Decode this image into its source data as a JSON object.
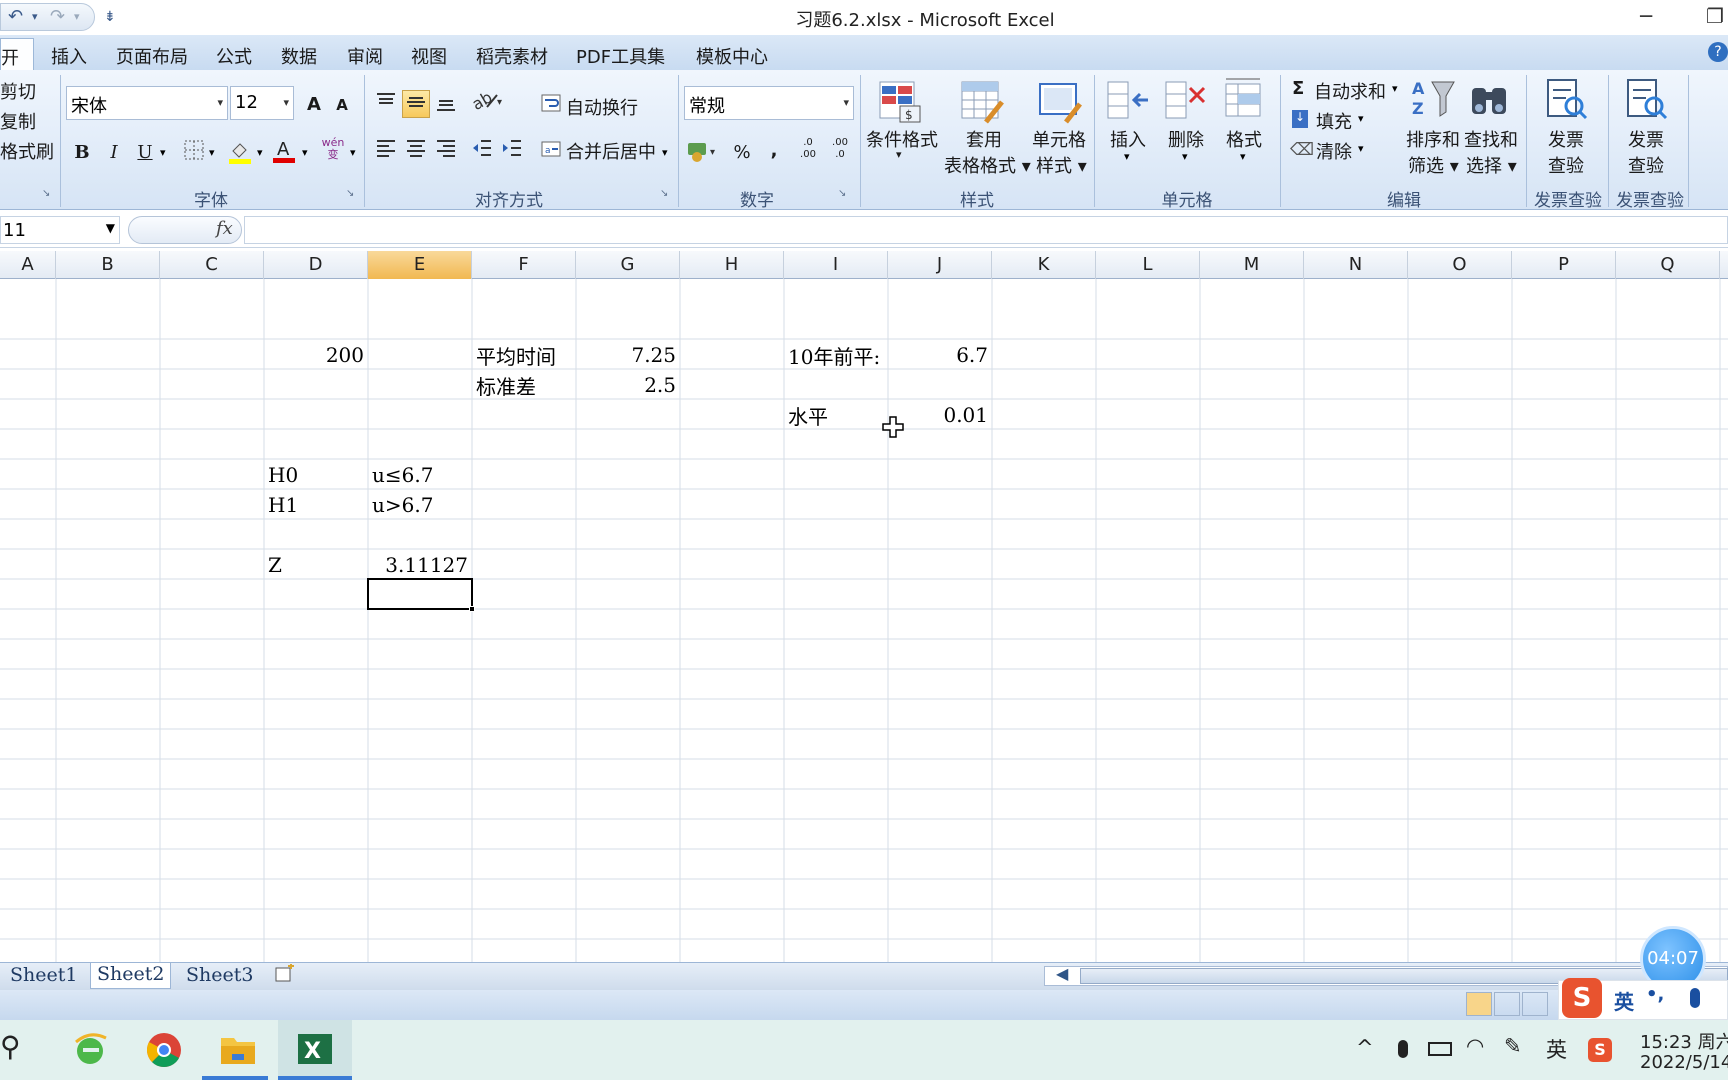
{
  "window": {
    "title": "习题6.2.xlsx - Microsoft Excel",
    "min": "─",
    "restore": "❐"
  },
  "qat": {
    "undo": "↶",
    "redo": "↷",
    "customize": "⇟"
  },
  "tabs": [
    {
      "label": "开始",
      "active": true
    },
    {
      "label": "插入"
    },
    {
      "label": "页面布局"
    },
    {
      "label": "公式"
    },
    {
      "label": "数据"
    },
    {
      "label": "审阅"
    },
    {
      "label": "视图"
    },
    {
      "label": "稻壳素材"
    },
    {
      "label": "PDF工具集"
    },
    {
      "label": "模板中心"
    }
  ],
  "help_icon": "?",
  "clipboard": {
    "cut": "剪切",
    "copy": "复制",
    "painter": "格式刷"
  },
  "font": {
    "name": "宋体",
    "size": "12",
    "grow": "A",
    "shrink": "A",
    "bold": "B",
    "italic": "I",
    "underline": "U",
    "phonetic": "wén\n变",
    "group_label": "字体"
  },
  "alignment": {
    "wrap": "自动换行",
    "merge": "合并后居中",
    "group_label": "对齐方式"
  },
  "number": {
    "format": "常规",
    "percent": "%",
    "comma": ",",
    "inc": ".0\n.00",
    "dec": ".00\n.0",
    "group_label": "数字"
  },
  "styles": {
    "cond_line1": "条件格式",
    "cond_line2": "▾",
    "table_line1": "套用",
    "table_line2": "表格格式 ▾",
    "cell_line1": "单元格",
    "cell_line2": "样式 ▾",
    "group_label": "样式"
  },
  "cells_group": {
    "insert": "插入",
    "delete": "删除",
    "format": "格式",
    "group_label": "单元格"
  },
  "editing": {
    "autosum": "自动求和",
    "fill": "填充",
    "clear": "清除",
    "sort_line1": "排序和",
    "sort_line2": "筛选 ▾",
    "find_line1": "查找和",
    "find_line2": "选择 ▾",
    "group_label": "编辑"
  },
  "invoice1": {
    "line1": "发票",
    "line2": "查验",
    "group_label": "发票查验"
  },
  "invoice2": {
    "line1": "发票",
    "line2": "查验",
    "group_label": "发票查验"
  },
  "formula_bar": {
    "name_box": "11",
    "fx": "fx",
    "content": ""
  },
  "columns": [
    "A",
    "B",
    "C",
    "D",
    "E",
    "F",
    "G",
    "H",
    "I",
    "J",
    "K",
    "L",
    "M",
    "N",
    "O",
    "P",
    "Q"
  ],
  "selected_column": "E",
  "cells": {
    "d3": "200",
    "f3": "平均时间",
    "g3": "7.25",
    "i3": "10年前平:",
    "j3": "6.7",
    "f4": "标准差",
    "g4": "2.5",
    "i5": "水平",
    "j5": "0.01",
    "d8": "H0",
    "e8": "u≤6.7",
    "d9": "H1",
    "e9": "u>6.7",
    "d11": "Z",
    "e11": "3.11127"
  },
  "sheets": [
    "Sheet1",
    "Sheet2",
    "Sheet3"
  ],
  "active_sheet": "Sheet2",
  "timer": "04:07",
  "ime": {
    "lang": "英",
    "punct": "•,",
    "mic": "🎤"
  },
  "taskbar": {
    "search": "⚲",
    "clock_time": "15:23 周六",
    "clock_date": "2022/5/14",
    "tray_lang": "英",
    "tray_up": "^"
  },
  "colors": {
    "accent": "#1f5fa8",
    "selection": "#f4c060",
    "taskbar": "#e2f1ee"
  }
}
